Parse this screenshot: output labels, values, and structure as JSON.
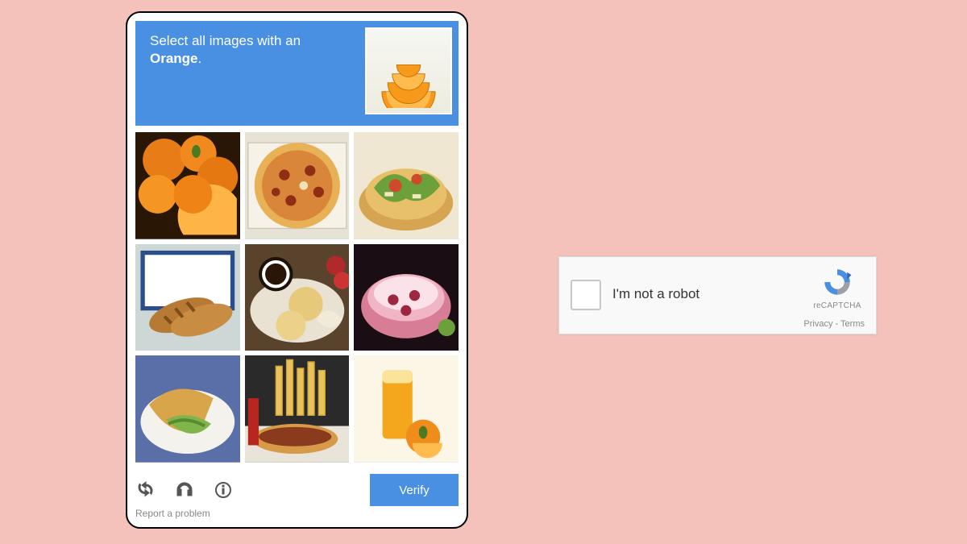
{
  "challenge": {
    "instruction_prefix": "Select all images with an",
    "target_word": "Orange",
    "period": ".",
    "sample_icon": "orange-slices-icon",
    "tiles": [
      {
        "name": "tile-oranges",
        "desc": "oranges"
      },
      {
        "name": "tile-pizza",
        "desc": "pizza"
      },
      {
        "name": "tile-salad",
        "desc": "salad"
      },
      {
        "name": "tile-bread",
        "desc": "bread on blue tile"
      },
      {
        "name": "tile-cookies-coffee",
        "desc": "cookies and coffee"
      },
      {
        "name": "tile-pink-jelly",
        "desc": "pink jelly dessert"
      },
      {
        "name": "tile-sandwich",
        "desc": "sandwich with lettuce"
      },
      {
        "name": "tile-fries-hotdog",
        "desc": "fries and hot dog"
      },
      {
        "name": "tile-orange-juice",
        "desc": "orange juice and oranges"
      }
    ],
    "toolbar": {
      "reload_icon": "reload-icon",
      "audio_icon": "headphones-icon",
      "info_icon": "info-icon"
    },
    "verify_label": "Verify",
    "report_label": "Report a problem"
  },
  "widget": {
    "checkbox_label": "I'm not a robot",
    "brand": "reCAPTCHA",
    "privacy": "Privacy",
    "terms": "Terms",
    "separator": " - "
  }
}
